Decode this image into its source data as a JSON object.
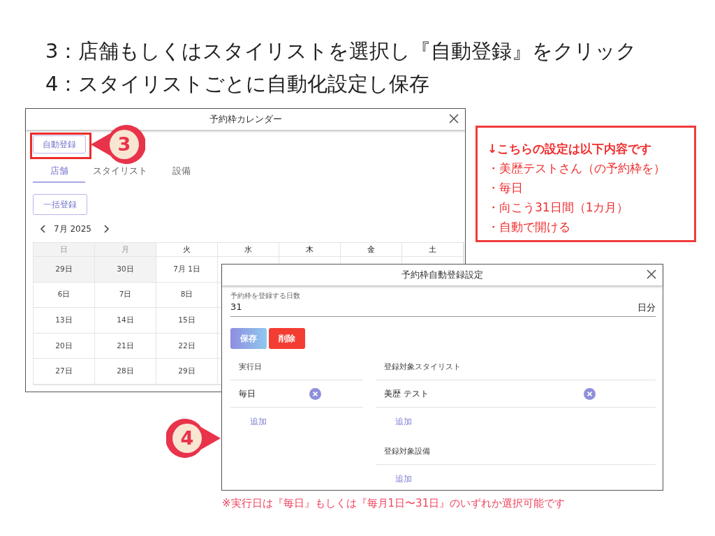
{
  "instructions": [
    "3：店舗もしくはスタイリストを選択し『自動登録』をクリック",
    "4：スタイリストごとに自動化設定し保存"
  ],
  "calendar_window": {
    "title": "予約枠カレンダー",
    "auto_button": {
      "label": "自動登録",
      "highlighted": true
    },
    "tabs": [
      {
        "label": "店舗",
        "selected": true
      },
      {
        "label": "スタイリスト",
        "selected": false
      },
      {
        "label": "設備",
        "selected": false
      }
    ],
    "bulk_button": "一括登録",
    "month": "7月 2025",
    "weekdays": [
      {
        "label": "日",
        "shaded": true
      },
      {
        "label": "月",
        "shaded": true
      },
      {
        "label": "火",
        "shaded": false
      },
      {
        "label": "水",
        "shaded": false
      },
      {
        "label": "木",
        "shaded": false
      },
      {
        "label": "金",
        "shaded": false
      },
      {
        "label": "土",
        "shaded": false
      }
    ],
    "weeks": [
      {
        "days": [
          {
            "label": "29日",
            "shaded": true
          },
          {
            "label": "30日",
            "shaded": true
          },
          {
            "label": "7月 1日",
            "shaded": false
          }
        ]
      },
      {
        "days": [
          {
            "label": "6日",
            "shaded": false
          },
          {
            "label": "7日",
            "shaded": false
          },
          {
            "label": "8日",
            "shaded": false
          }
        ]
      },
      {
        "days": [
          {
            "label": "13日",
            "shaded": false
          },
          {
            "label": "14日",
            "shaded": false
          },
          {
            "label": "15日",
            "shaded": false
          }
        ]
      },
      {
        "days": [
          {
            "label": "20日",
            "shaded": false
          },
          {
            "label": "21日",
            "shaded": false
          },
          {
            "label": "22日",
            "shaded": false
          }
        ]
      },
      {
        "days": [
          {
            "label": "27日",
            "shaded": false
          },
          {
            "label": "28日",
            "shaded": false
          },
          {
            "label": "29日",
            "shaded": false
          }
        ]
      }
    ]
  },
  "callouts": [
    {
      "number": "3"
    },
    {
      "number": "4"
    }
  ],
  "info_box": {
    "heading": "↓こちらの設定は以下内容です",
    "items": [
      "・美歴テストさん（の予約枠を）",
      "・毎日",
      "・向こう31日間（1カ月）",
      "・自動で開ける"
    ]
  },
  "settings_dialog": {
    "title": "予約枠自動登録設定",
    "days_field": {
      "label": "予約枠を登録する日数",
      "value": "31",
      "unit": "日分"
    },
    "save_button": "保存",
    "delete_button": "削除",
    "run_day": {
      "header": "実行日",
      "items": [
        "毎日"
      ],
      "add": "追加"
    },
    "stylists": {
      "header": "登録対象スタイリスト",
      "items": [
        "美歴 テスト"
      ],
      "add": "追加"
    },
    "equipment": {
      "header": "登録対象設備",
      "add": "追加"
    }
  },
  "note": "※実行日は『毎日』もしくは『毎月1日〜31日』のいずれか選択可能です"
}
